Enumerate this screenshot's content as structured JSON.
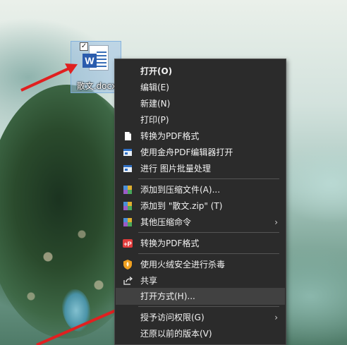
{
  "desktop": {
    "file": {
      "name": "散文.docx",
      "icon": "word-document-icon"
    }
  },
  "context_menu": {
    "items": [
      {
        "label": "打开(O)",
        "bold": true
      },
      {
        "label": "编辑(E)"
      },
      {
        "label": "新建(N)"
      },
      {
        "label": "打印(P)"
      },
      {
        "label": "转换为PDF格式",
        "icon": "pdf-page-icon"
      },
      {
        "label": "使用金舟PDF编辑器打开",
        "icon": "pdf-editor-icon"
      },
      {
        "label": "进行 图片批量处理",
        "icon": "image-batch-icon"
      },
      {
        "label": "添加到压缩文件(A)...",
        "icon": "archive-icon"
      },
      {
        "label": "添加到 \"散文.zip\" (T)",
        "icon": "archive-icon"
      },
      {
        "label": "其他压缩命令",
        "icon": "archive-icon",
        "submenu": true
      },
      {
        "label": "转换为PDF格式",
        "icon": "pdf-convert-red-icon"
      },
      {
        "label": "使用火绒安全进行杀毒",
        "icon": "huorong-shield-icon"
      },
      {
        "label": "共享",
        "icon": "share-icon"
      },
      {
        "label": "打开方式(H)...",
        "hover": true
      },
      {
        "label": "授予访问权限(G)",
        "submenu": true
      },
      {
        "label": "还原以前的版本(V)"
      }
    ],
    "submenu_glyph": "›"
  },
  "colors": {
    "menu_bg": "#2b2b2b",
    "menu_hover": "#414141",
    "menu_text": "#f2f2f2",
    "arrow": "#e02020"
  }
}
